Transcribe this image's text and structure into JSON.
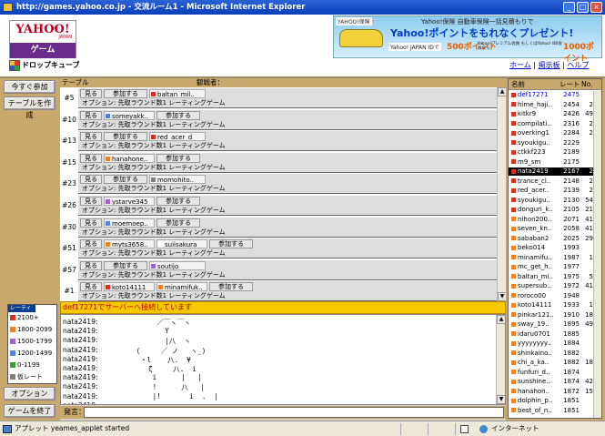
{
  "window": {
    "title": "http://games.yahoo.co.jp - 交流ルーム1 - Microsoft Internet Explorer"
  },
  "logo": {
    "line1": "YAHOO!",
    "line2": "JAPAN",
    "line3": "ゲーム"
  },
  "game": {
    "title": "ドロップキューブ"
  },
  "ad": {
    "badge": "YAHOO!保険",
    "line1": "Yahoo!保険 自動車保険一括見積もりで",
    "line2": "Yahoo!ポイントをもれなくプレゼント!",
    "line3": "Yahoo! JAPAN IDで",
    "points1": "500ポイント",
    "line4": "Yahoo!プレミアム会員 もしくはYahoo! BB会員なら",
    "points2": "1000ポイント"
  },
  "toplinks": {
    "home": "ホーム",
    "board": "掲示板",
    "help": "ヘルプ",
    "sep": " | "
  },
  "left": {
    "buttons": [
      "今すぐ参加",
      "テーブルを作成",
      "オプション",
      "ゲームを終了"
    ],
    "legend_title": "レーティング",
    "legend": [
      {
        "label": "2100+",
        "color": "#d83020"
      },
      {
        "label": "1800-2099",
        "color": "#f08020"
      },
      {
        "label": "1500-1799",
        "color": "#a060d0"
      },
      {
        "label": "1200-1499",
        "color": "#5080e0"
      },
      {
        "label": "0-1199",
        "color": "#30a030"
      },
      {
        "label": "仮レート",
        "color": "#808080"
      }
    ]
  },
  "tables": {
    "header": "テーブル",
    "header2": "観戦者：",
    "view": "見る",
    "join": "参加する",
    "option": "オプション: 先取ラウンド数1 レーティングゲーム",
    "rows": [
      {
        "num": "#5",
        "players": [
          {
            "name": "baltan_mil..",
            "color": "#d83020"
          }
        ]
      },
      {
        "num": "#10",
        "players": [
          {
            "name": "someyakk..",
            "color": "#5080e0"
          }
        ]
      },
      {
        "num": "#13",
        "players": [
          {
            "name": "red_acer_d",
            "color": "#d83020"
          }
        ]
      },
      {
        "num": "#15",
        "players": [
          {
            "name": "hanahone..",
            "color": "#f08020"
          }
        ]
      },
      {
        "num": "#23",
        "players": [
          {
            "name": "momohito..",
            "color": "#808080"
          }
        ]
      },
      {
        "num": "#26",
        "players": [
          {
            "name": "ystarve345",
            "color": "#a060d0"
          }
        ]
      },
      {
        "num": "#30",
        "players": [
          {
            "name": "moemoep..",
            "color": "#5080e0"
          }
        ]
      },
      {
        "num": "#51",
        "players": [
          {
            "name": "myts3658..",
            "color": "#f08020"
          },
          {
            "name": "suiisakura",
            "color": "#ffffff"
          }
        ]
      },
      {
        "num": "#57",
        "players": [
          {
            "name": "soutijo",
            "color": "#a060d0"
          }
        ]
      },
      {
        "num": "#1",
        "players": [
          {
            "name": "koto14111",
            "color": "#d83020"
          },
          {
            "name": "minamifuk..",
            "color": "#f08020"
          }
        ]
      }
    ]
  },
  "status_msg": "def17271でサーバーへ接続しています",
  "chat": {
    "user": "nata2419:",
    "lines": 10,
    "art": [
      "          ／￣ヽ￣ヽ",
      "            Y",
      "            |八  ヽ",
      "     (     ／ ノ   ヽ_)",
      "      ・l    八.  ¥",
      "        ζ     八.  i",
      "         i      |   |",
      "         !      八   |",
      "         |!       i  .  |"
    ]
  },
  "input": {
    "label": "発言："
  },
  "users": {
    "h_name": "名前",
    "h_rate": "レート",
    "h_no": "No.",
    "rows": [
      {
        "name": "def17271",
        "rate": "2475",
        "no": "",
        "color": "#d83020",
        "sel": false,
        "link": true
      },
      {
        "name": "hime_haji..",
        "rate": "2454",
        "no": "2",
        "color": "#d83020",
        "sel": false
      },
      {
        "name": "kitkr9",
        "rate": "2426",
        "no": "49",
        "color": "#d83020",
        "sel": false
      },
      {
        "name": "compilati..",
        "rate": "2316",
        "no": "2",
        "color": "#d83020",
        "sel": false
      },
      {
        "name": "overking1",
        "rate": "2284",
        "no": "2",
        "color": "#d83020",
        "sel": false
      },
      {
        "name": "syoukigu..",
        "rate": "2229",
        "no": "",
        "color": "#d83020",
        "sel": false
      },
      {
        "name": "ctkkf223",
        "rate": "2189",
        "no": "",
        "color": "#d83020",
        "sel": false
      },
      {
        "name": "m9_sm",
        "rate": "2175",
        "no": "",
        "color": "#d83020",
        "sel": false
      },
      {
        "name": "nata2419",
        "rate": "2167",
        "no": "2",
        "color": "#d83020",
        "sel": true
      },
      {
        "name": "trance_cl..",
        "rate": "2148",
        "no": "2",
        "color": "#d83020",
        "sel": false
      },
      {
        "name": "red_acer..",
        "rate": "2139",
        "no": "2",
        "color": "#d83020",
        "sel": false
      },
      {
        "name": "syoukigu..",
        "rate": "2130",
        "no": "54",
        "color": "#d83020",
        "sel": false
      },
      {
        "name": "donguri_k..",
        "rate": "2105",
        "no": "21",
        "color": "#d83020",
        "sel": false
      },
      {
        "name": "nihon200..",
        "rate": "2071",
        "no": "41",
        "color": "#f08020",
        "sel": false
      },
      {
        "name": "seven_kn..",
        "rate": "2058",
        "no": "41",
        "color": "#f08020",
        "sel": false
      },
      {
        "name": "sababan2",
        "rate": "2025",
        "no": "29",
        "color": "#f08020",
        "sel": false
      },
      {
        "name": "beko014",
        "rate": "1993",
        "no": "",
        "color": "#f08020",
        "sel": false
      },
      {
        "name": "minamifu..",
        "rate": "1987",
        "no": "1",
        "color": "#f08020",
        "sel": false
      },
      {
        "name": "mc_get_h..",
        "rate": "1977",
        "no": "",
        "color": "#f08020",
        "sel": false
      },
      {
        "name": "baltan_mi..",
        "rate": "1975",
        "no": "5",
        "color": "#f08020",
        "sel": false
      },
      {
        "name": "supersub..",
        "rate": "1972",
        "no": "41",
        "color": "#f08020",
        "sel": false
      },
      {
        "name": "roroco00",
        "rate": "1948",
        "no": "",
        "color": "#f08020",
        "sel": false
      },
      {
        "name": "koto14111",
        "rate": "1933",
        "no": "1",
        "color": "#f08020",
        "sel": false
      },
      {
        "name": "pinkar121..",
        "rate": "1910",
        "no": "18",
        "color": "#f08020",
        "sel": false
      },
      {
        "name": "sway_19..",
        "rate": "1895",
        "no": "49",
        "color": "#f08020",
        "sel": false
      },
      {
        "name": "idaru0701",
        "rate": "1885",
        "no": "",
        "color": "#f08020",
        "sel": false
      },
      {
        "name": "yyyyyyyy..",
        "rate": "1884",
        "no": "",
        "color": "#f08020",
        "sel": false
      },
      {
        "name": "shinkaino..",
        "rate": "1882",
        "no": "",
        "color": "#f08020",
        "sel": false
      },
      {
        "name": "chi_a_ka..",
        "rate": "1882",
        "no": "18",
        "color": "#f08020",
        "sel": false
      },
      {
        "name": "funfuri_d..",
        "rate": "1874",
        "no": "",
        "color": "#f08020",
        "sel": false
      },
      {
        "name": "sunshine..",
        "rate": "1874",
        "no": "42",
        "color": "#f08020",
        "sel": false
      },
      {
        "name": "hanahon..",
        "rate": "1872",
        "no": "15",
        "color": "#f08020",
        "sel": false
      },
      {
        "name": "dolphin_p..",
        "rate": "1851",
        "no": "",
        "color": "#f08020",
        "sel": false
      },
      {
        "name": "best_of_n..",
        "rate": "1851",
        "no": "",
        "color": "#f08020",
        "sel": false
      }
    ]
  },
  "statusbar": {
    "text": "アプレット yeames_applet started",
    "zone": "インターネット"
  }
}
